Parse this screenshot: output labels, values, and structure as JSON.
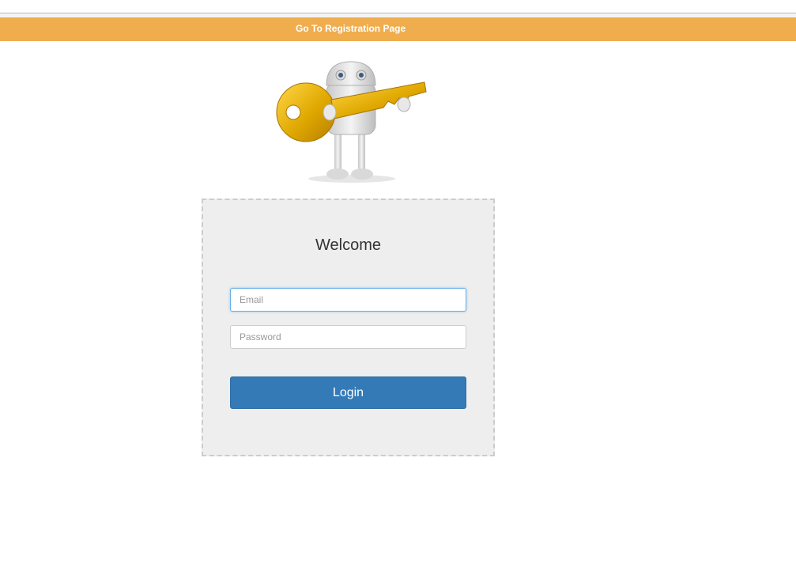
{
  "nav": {
    "registration_link": "Go To Registration Page",
    "bar_color": "#f0ad4e"
  },
  "hero": {
    "icon": "robot-holding-key-icon"
  },
  "login": {
    "heading": "Welcome",
    "email_placeholder": "Email",
    "email_value": "",
    "password_placeholder": "Password",
    "password_value": "",
    "button_label": "Login",
    "button_color": "#337ab7"
  }
}
